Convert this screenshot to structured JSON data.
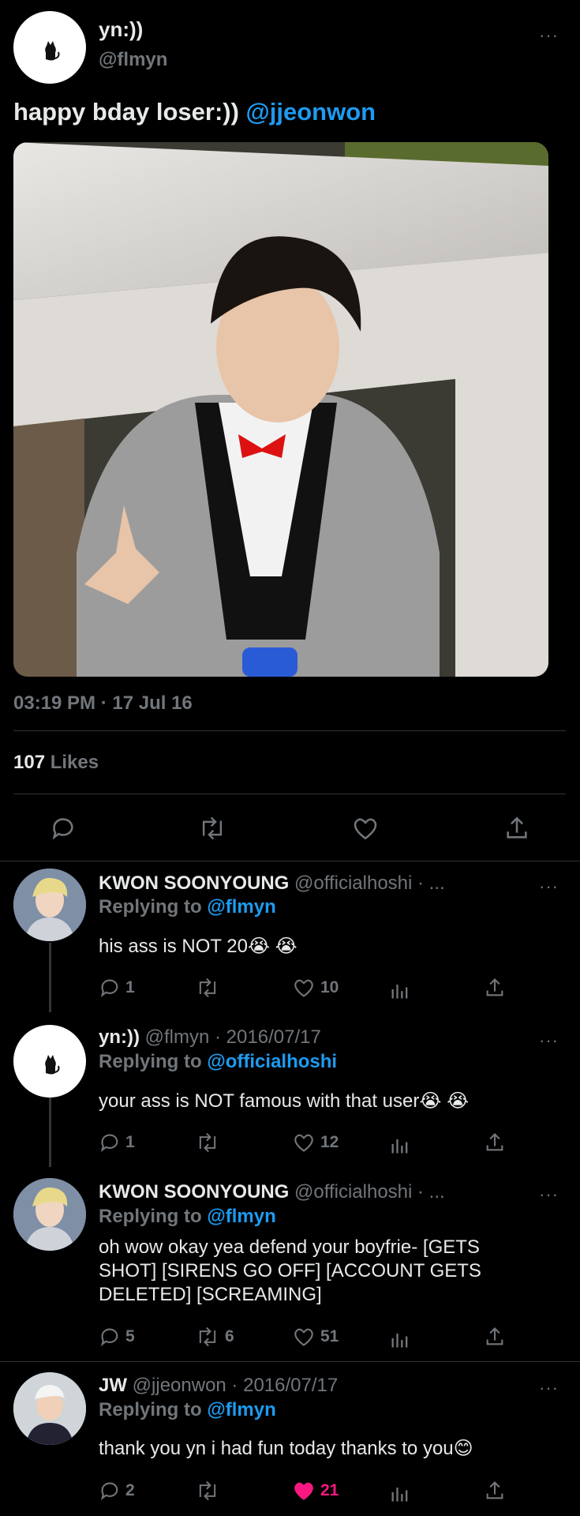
{
  "main_tweet": {
    "display_name": "yn:))",
    "handle": "@flmyn",
    "more": "···",
    "text": "happy bday loser:)) ",
    "mention": "@jjeonwon",
    "time": "03:19 PM · 17 Jul 16",
    "likes_count": "107",
    "likes_label": "Likes"
  },
  "replies": [
    {
      "name": "KWON SOONYOUNG",
      "handle_date": " @officialhoshi · ...",
      "replying_prefix": "Replying to ",
      "replying_to": "@flmyn",
      "text": "his ass is NOT 20😭 😭",
      "reply_count": "1",
      "retweet_count": "",
      "like_count": "10"
    },
    {
      "name": "yn:))",
      "handle_date": " @flmyn · 2016/07/17",
      "replying_prefix": "Replying to ",
      "replying_to": "@officialhoshi",
      "text": "your ass is NOT famous with that user😭 😭",
      "reply_count": "1",
      "retweet_count": "",
      "like_count": "12"
    },
    {
      "name": "KWON SOONYOUNG",
      "handle_date": " @officialhoshi · ...",
      "replying_prefix": "Replying to ",
      "replying_to": "@flmyn",
      "text": "oh wow okay yea defend your boyfrie- [GETS SHOT] [SIRENS GO OFF] [ACCOUNT GETS DELETED] [SCREAMING]",
      "reply_count": "5",
      "retweet_count": "6",
      "like_count": "51"
    },
    {
      "name": "JW",
      "handle_date": " @jjeonwon · 2016/07/17",
      "replying_prefix": "Replying to ",
      "replying_to": "@flmyn",
      "text": "thank you yn i had fun today thanks to you😊",
      "reply_count": "2",
      "retweet_count": "",
      "like_count": "21"
    }
  ],
  "colors": {
    "background": "#000000",
    "accent": "#1d9bf0",
    "muted": "#71767b",
    "like_active": "#f91880"
  },
  "icons": [
    "reply-icon",
    "retweet-icon",
    "like-icon",
    "share-icon",
    "analytics-icon",
    "more-icon",
    "cat-avatar-icon"
  ]
}
